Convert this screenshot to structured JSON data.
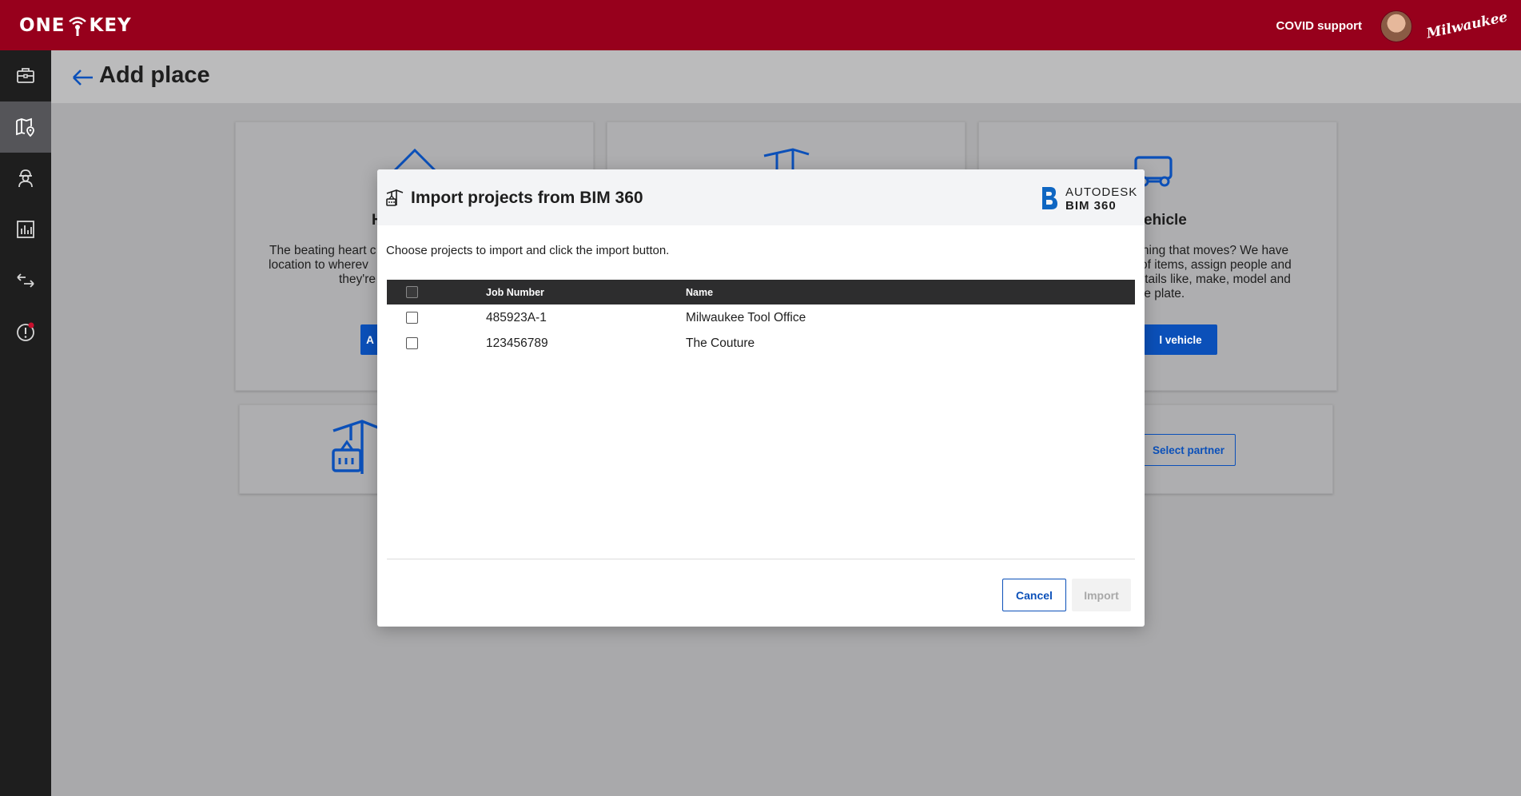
{
  "app": {
    "logo_text": "ONE KEY",
    "covid_link": "COVID support",
    "brand": "Milwaukee"
  },
  "sidebar": {
    "items": [
      {
        "icon": "toolbox-icon"
      },
      {
        "icon": "map-pin-icon",
        "active": true
      },
      {
        "icon": "worker-icon"
      },
      {
        "icon": "bar-chart-icon"
      },
      {
        "icon": "transfer-icon"
      },
      {
        "icon": "alert-icon"
      }
    ]
  },
  "page": {
    "title": "Add place"
  },
  "background_cards": {
    "card1": {
      "title_fragment": "H",
      "text_lines": [
        "The beating heart c",
        "location to wherev",
        "they're"
      ],
      "button_fragment": "A"
    },
    "card3": {
      "title_fragment": "ehicle",
      "text_lines": [
        "ething that moves? We have",
        "k of items, assign people and",
        "details like, make, model and",
        "nse plate."
      ],
      "button_fragment": "l vehicle"
    },
    "card4": {
      "button": "Select partner"
    }
  },
  "modal": {
    "title": "Import projects from BIM 360",
    "vendor_line1": "AUTODESK",
    "vendor_line2": "BIM 360",
    "description": "Choose projects to import and click the import button.",
    "table": {
      "headers": [
        "Job Number",
        "Name"
      ],
      "rows": [
        {
          "job_number": "485923A-1",
          "name": "Milwaukee Tool Office"
        },
        {
          "job_number": "123456789",
          "name": "The Couture"
        }
      ]
    },
    "cancel_label": "Cancel",
    "import_label": "Import"
  },
  "colors": {
    "topbar": "#97001c",
    "sidebar": "#1e1e1e",
    "accent": "#0b50b9"
  }
}
